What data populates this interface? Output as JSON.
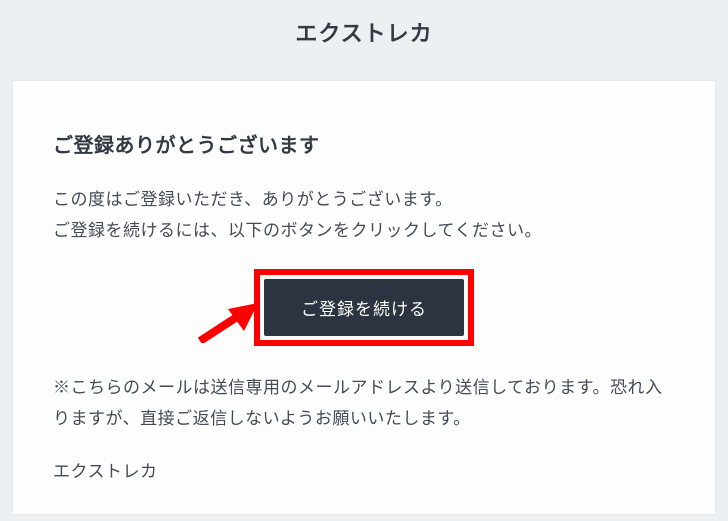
{
  "header": {
    "title": "エクストレカ"
  },
  "main": {
    "heading": "ご登録ありがとうございます",
    "body_line1": "この度はご登録いただき、ありがとうございます。",
    "body_line2": "ご登録を続けるには、以下のボタンをクリックしてください。",
    "button_label": "ご登録を続ける",
    "note": "※こちらのメールは送信専用のメールアドレスより送信しております。恐れ入りますが、直接ご返信しないようお願いいたします。",
    "signature": "エクストレカ"
  },
  "annotation": {
    "highlight_color": "#ff0000",
    "arrow_color": "#ff0000"
  }
}
